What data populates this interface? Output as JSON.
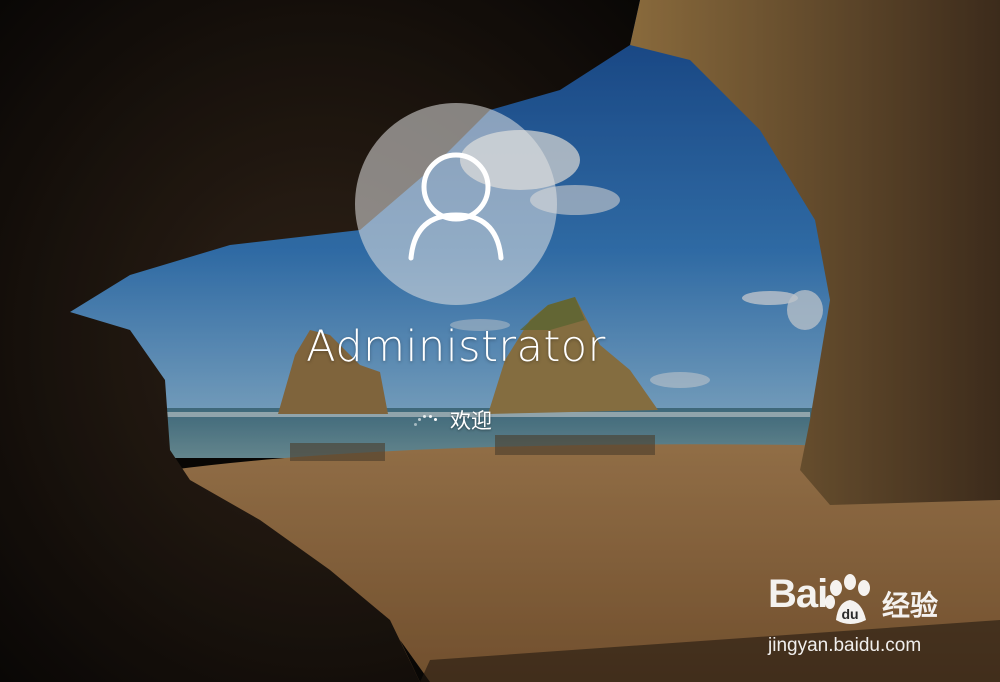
{
  "lock_screen": {
    "user": {
      "name": "Administrator",
      "avatar_icon": "user-silhouette-icon"
    },
    "status": {
      "spinner_icon": "loading-dots-icon",
      "text": "欢迎"
    },
    "background": {
      "description_colors": {
        "sky": "#2f6fb5",
        "rock": "#8a6a3a",
        "sand": "#a47a4a",
        "cave": "#1a140f"
      }
    }
  },
  "watermark": {
    "logo_text": "Bai",
    "logo_suffix": "经验",
    "paw_icon": "baidu-paw-icon",
    "url": "jingyan.baidu.com"
  }
}
